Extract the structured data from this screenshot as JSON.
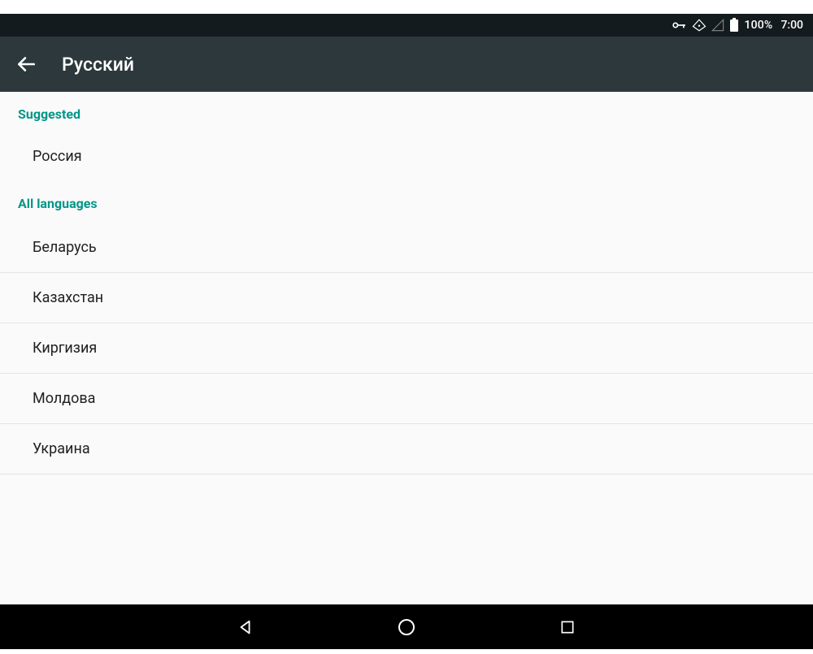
{
  "status": {
    "battery_percent": "100%",
    "time": "7:00"
  },
  "appbar": {
    "title": "Русский"
  },
  "sections": {
    "suggested_header": "Suggested",
    "suggested_items": [
      "Россия"
    ],
    "all_header": "All languages",
    "all_items": [
      "Беларусь",
      "Казахстан",
      "Киргизия",
      "Молдова",
      "Украина"
    ]
  }
}
